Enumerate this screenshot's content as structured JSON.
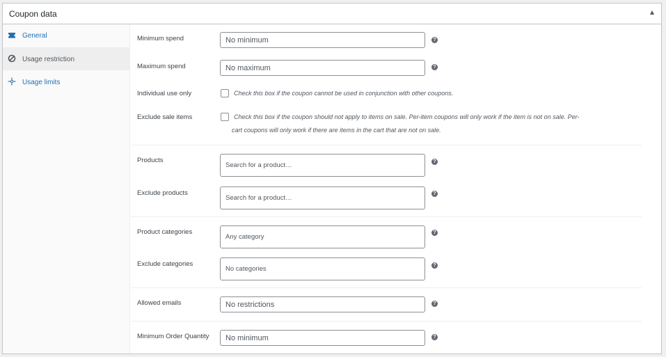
{
  "panel": {
    "title": "Coupon data"
  },
  "sidebar": {
    "tabs": [
      {
        "label": "General",
        "icon": "ticket-icon",
        "active": false
      },
      {
        "label": "Usage restriction",
        "icon": "block-icon",
        "active": true
      },
      {
        "label": "Usage limits",
        "icon": "crosshair-icon",
        "active": false
      }
    ]
  },
  "fields": {
    "minimum_spend": {
      "label": "Minimum spend",
      "placeholder": "No minimum"
    },
    "maximum_spend": {
      "label": "Maximum spend",
      "placeholder": "No maximum"
    },
    "individual_use": {
      "label": "Individual use only",
      "description": "Check this box if the coupon cannot be used in conjunction with other coupons.",
      "checked": false
    },
    "exclude_sale": {
      "label": "Exclude sale items",
      "description_line1": "Check this box if the coupon should not apply to items on sale. Per-item coupons will only work if the item is not on sale. Per-",
      "description_line2": "cart coupons will only work if there are items in the cart that are not on sale.",
      "checked": false
    },
    "products": {
      "label": "Products",
      "placeholder": "Search for a product…"
    },
    "exclude_products": {
      "label": "Exclude products",
      "placeholder": "Search for a product…"
    },
    "product_categories": {
      "label": "Product categories",
      "placeholder": "Any category"
    },
    "exclude_categories": {
      "label": "Exclude categories",
      "placeholder": "No categories"
    },
    "allowed_emails": {
      "label": "Allowed emails",
      "placeholder": "No restrictions"
    },
    "min_order_qty": {
      "label": "Minimum Order Quantity",
      "placeholder": "No minimum"
    }
  },
  "help_glyph": "?",
  "colors": {
    "link": "#2271b1",
    "border": "#c3c4c7",
    "active_tab_bg": "#eeeeee"
  }
}
